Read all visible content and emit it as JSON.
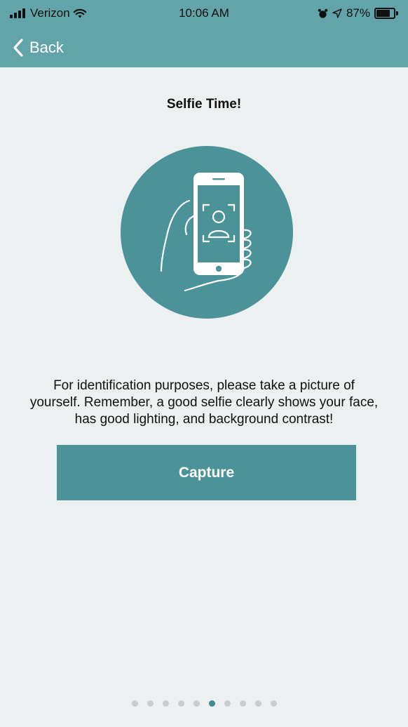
{
  "status_bar": {
    "carrier": "Verizon",
    "time": "10:06 AM",
    "battery": "87%",
    "battery_level": 0.87
  },
  "nav": {
    "back_label": "Back"
  },
  "main": {
    "title": "Selfie Time!",
    "description": "For identification purposes, please take a picture of yourself. Remember, a good selfie clearly shows your face, has good lighting, and background contrast!",
    "capture_label": "Capture"
  },
  "pagination": {
    "total": 10,
    "active_index": 5
  },
  "colors": {
    "header": "#62a4a8",
    "accent": "#4b9398",
    "background": "#edf0f1"
  }
}
